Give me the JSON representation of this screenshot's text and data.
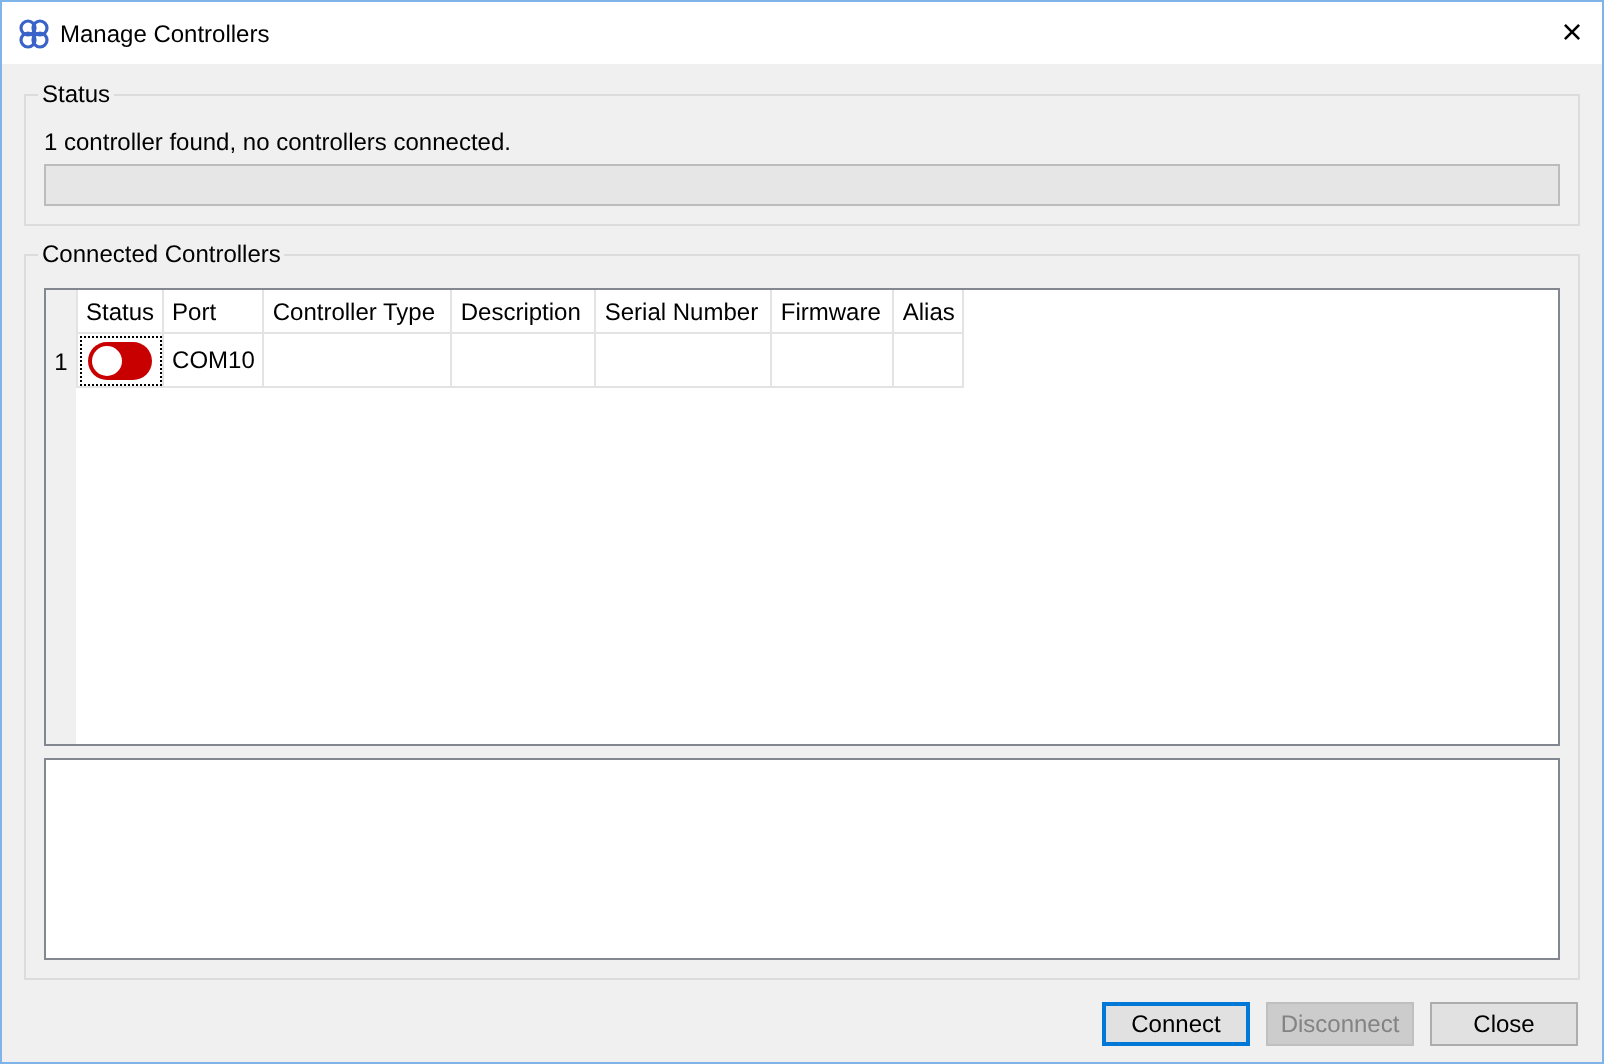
{
  "window": {
    "title": "Manage Controllers",
    "close": "×"
  },
  "status": {
    "title": "Status",
    "message": "1 controller found, no controllers connected.",
    "level": 0
  },
  "controllers": {
    "title": "Connected Controllers",
    "columns": [
      "Status",
      "Port",
      "Controller Type",
      "Description",
      "Serial Number",
      "Firmware",
      "Alias"
    ],
    "rows": [
      {
        "index": "1",
        "connected": false,
        "port": "COM10"
      }
    ]
  },
  "buttons": [
    {
      "label": "Connect",
      "default": true,
      "disabled": false
    },
    {
      "label": "Disconnect",
      "default": false,
      "disabled": true
    },
    {
      "label": "Close",
      "default": false,
      "disabled": false
    }
  ]
}
